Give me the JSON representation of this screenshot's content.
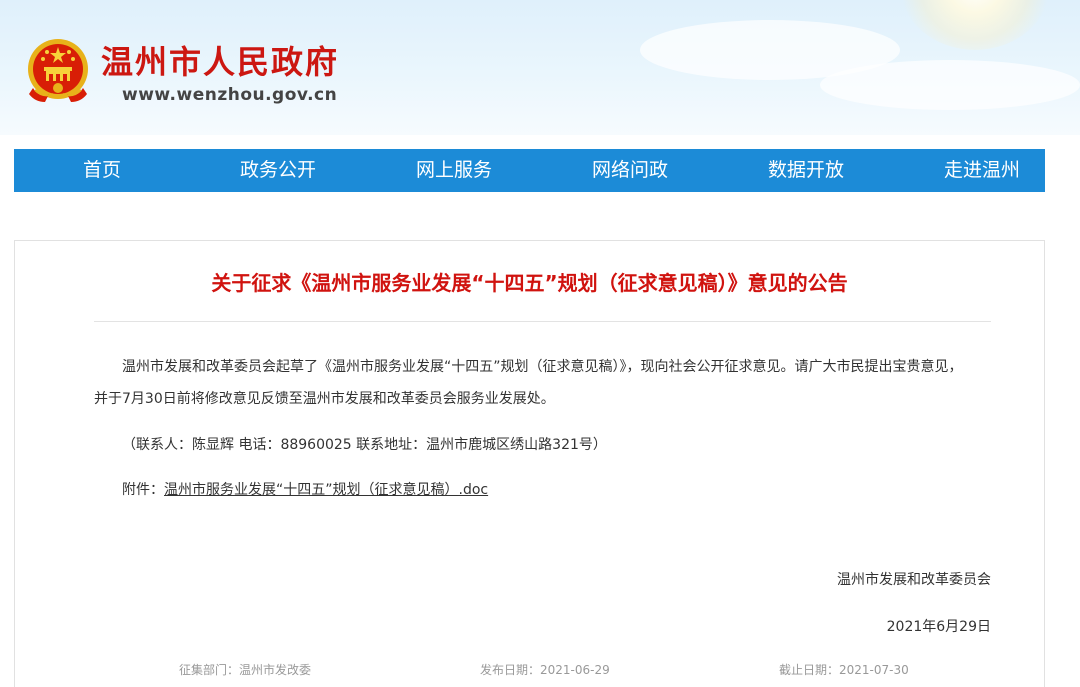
{
  "header": {
    "site_name": "温州市人民政府",
    "site_domain": "www.wenzhou.gov.cn"
  },
  "nav": {
    "items": [
      {
        "label": "首页"
      },
      {
        "label": "政务公开"
      },
      {
        "label": "网上服务"
      },
      {
        "label": "网络问政"
      },
      {
        "label": "数据开放"
      },
      {
        "label": "走进温州"
      }
    ]
  },
  "article": {
    "title": "关于征求《温州市服务业发展“十四五”规划（征求意见稿）》意见的公告",
    "body_line1": "温州市发展和改革委员会起草了《温州市服务业发展“十四五”规划（征求意见稿）》，现向社会公开征求意见。请广大市民提出宝贵意见，",
    "body_line2": "并于7月30日前将修改意见反馈至温州市发展和改革委员会服务业发展处。",
    "contact": "（联系人：陈显辉 电话：88960025 联系地址：温州市鹿城区绣山路321号）",
    "attachment_label": "附件：",
    "attachment_file": "温州市服务业发展“十四五”规划（征求意见稿）.doc",
    "signature_org": "温州市发展和改革委员会",
    "signature_date": "2021年6月29日",
    "dept": "征集部门：温州市发改委",
    "publish_date": "发布日期：2021-06-29",
    "deadline": "截止日期：2021-07-30"
  },
  "colors": {
    "nav_bg": "#1c8bd7",
    "title_red": "#d0130f",
    "brand_red": "#cc1711"
  }
}
